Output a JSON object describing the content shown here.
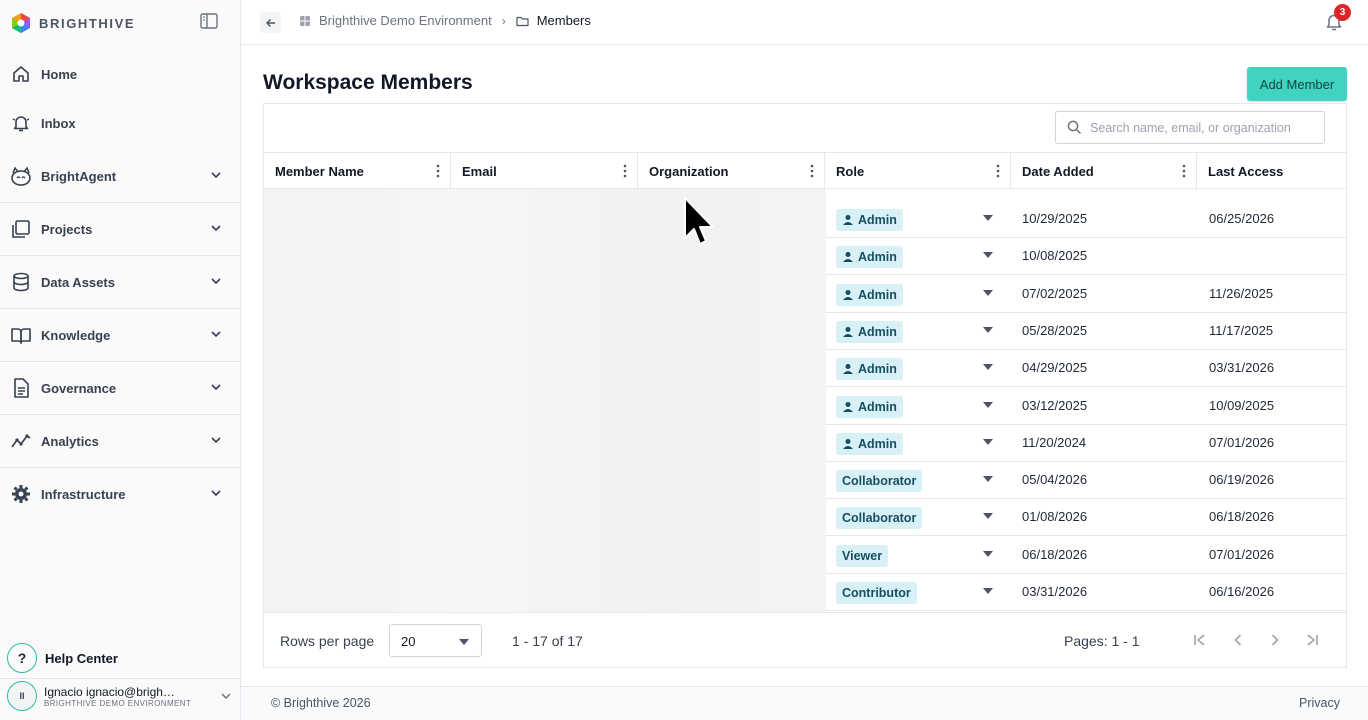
{
  "brand": {
    "name": "BRIGHTHIVE"
  },
  "sidebar": {
    "items": [
      {
        "label": "Home",
        "icon": "home-icon"
      },
      {
        "label": "Inbox",
        "icon": "bell-icon"
      },
      {
        "label": "BrightAgent",
        "icon": "agent-icon"
      },
      {
        "label": "Projects",
        "icon": "projects-icon"
      },
      {
        "label": "Data Assets",
        "icon": "database-icon"
      },
      {
        "label": "Knowledge",
        "icon": "book-icon"
      },
      {
        "label": "Governance",
        "icon": "document-icon"
      },
      {
        "label": "Analytics",
        "icon": "analytics-icon"
      },
      {
        "label": "Infrastructure",
        "icon": "gear-icon"
      }
    ],
    "help_label": "Help Center",
    "user": {
      "initials": "II",
      "name": "Ignacio ignacio@brigh…",
      "env": "BRIGHTHIVE DEMO ENVIRONMENT"
    }
  },
  "topbar": {
    "breadcrumbs": [
      "Brighthive Demo Environment",
      "Members"
    ],
    "notification_count": "3"
  },
  "page": {
    "title": "Workspace Members",
    "add_label": "Add Member"
  },
  "search": {
    "placeholder": "Search name, email, or organization"
  },
  "table": {
    "columns": [
      "Member Name",
      "Email",
      "Organization",
      "Role",
      "Date Added",
      "Last Access"
    ],
    "rows": [
      {
        "role": "Admin",
        "date_added": "10/29/2025",
        "last_access": "06/25/2026"
      },
      {
        "role": "Admin",
        "date_added": "10/08/2025",
        "last_access": ""
      },
      {
        "role": "Admin",
        "date_added": "07/02/2025",
        "last_access": "11/26/2025"
      },
      {
        "role": "Admin",
        "date_added": "05/28/2025",
        "last_access": "11/17/2025"
      },
      {
        "role": "Admin",
        "date_added": "04/29/2025",
        "last_access": "03/31/2026"
      },
      {
        "role": "Admin",
        "date_added": "03/12/2025",
        "last_access": "10/09/2025"
      },
      {
        "role": "Admin",
        "date_added": "11/20/2024",
        "last_access": "07/01/2026"
      },
      {
        "role": "Collaborator",
        "date_added": "05/04/2026",
        "last_access": "06/19/2026"
      },
      {
        "role": "Collaborator",
        "date_added": "01/08/2026",
        "last_access": "06/18/2026"
      },
      {
        "role": "Viewer",
        "date_added": "06/18/2026",
        "last_access": "07/01/2026"
      },
      {
        "role": "Contributor",
        "date_added": "03/31/2026",
        "last_access": "06/16/2026"
      }
    ]
  },
  "pagination": {
    "rows_per_page_label": "Rows per page",
    "rows_per_page": "20",
    "range": "1 - 17 of 17",
    "pages": "Pages: 1 - 1"
  },
  "footer": {
    "copyright": "© Brighthive 2026",
    "privacy": "Privacy"
  },
  "colors": {
    "accent": "#40d4c0",
    "chip_bg": "#d8f1f6",
    "badge": "#dc2626"
  }
}
